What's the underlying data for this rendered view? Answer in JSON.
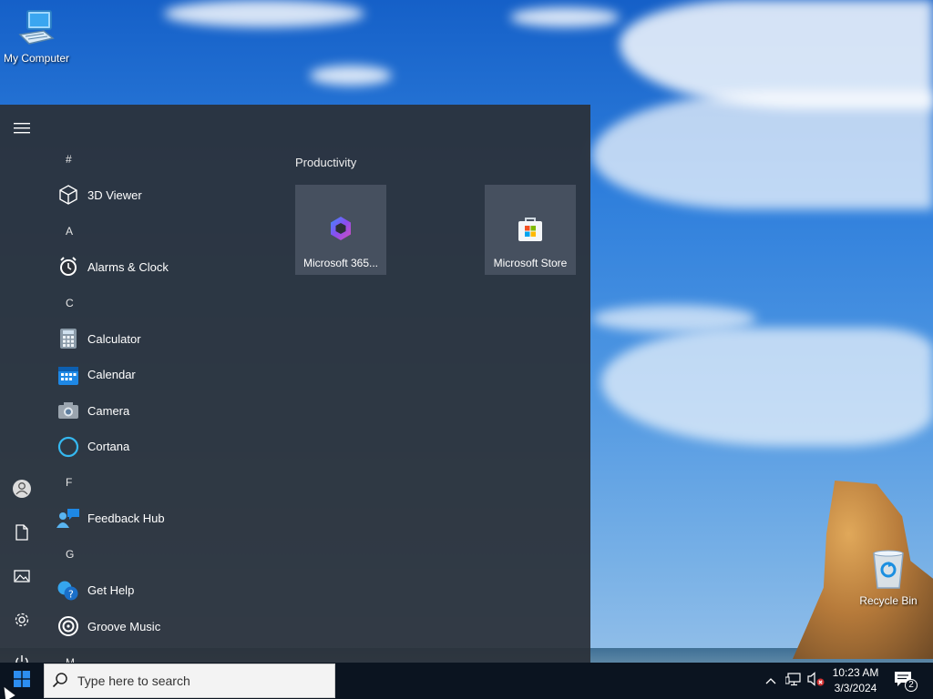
{
  "desktop": {
    "icons": [
      {
        "label": "My Computer",
        "icon": "computer-icon"
      },
      {
        "label": "Recycle Bin",
        "icon": "recycle-bin-icon"
      }
    ]
  },
  "start_menu": {
    "rail": [
      {
        "icon": "hamburger-menu-icon"
      },
      {
        "icon": "user-account-icon"
      },
      {
        "icon": "documents-icon"
      },
      {
        "icon": "pictures-icon"
      },
      {
        "icon": "settings-gear-icon"
      },
      {
        "icon": "power-icon"
      }
    ],
    "list": {
      "hash": "#",
      "a": "A",
      "c": "C",
      "f": "F",
      "g": "G",
      "m": "M",
      "apps": {
        "viewer3d": "3D Viewer",
        "alarms": "Alarms & Clock",
        "calculator": "Calculator",
        "calendar": "Calendar",
        "camera": "Camera",
        "cortana": "Cortana",
        "feedback": "Feedback Hub",
        "gethelp": "Get Help",
        "groove": "Groove Music"
      }
    },
    "tiles_group": "Productivity",
    "tiles": [
      {
        "label": "Microsoft 365...",
        "icon": "microsoft-365-icon"
      },
      {
        "label": "Microsoft Store",
        "icon": "microsoft-store-icon"
      }
    ]
  },
  "taskbar": {
    "search_placeholder": "Type here to search",
    "clock_time": "10:23 AM",
    "clock_date": "3/3/2024",
    "notification_count": "2"
  },
  "colors": {
    "start_menu_bg": "#2b3038",
    "taskbar_bg": "#0b1420",
    "accent": "#0078d7"
  }
}
